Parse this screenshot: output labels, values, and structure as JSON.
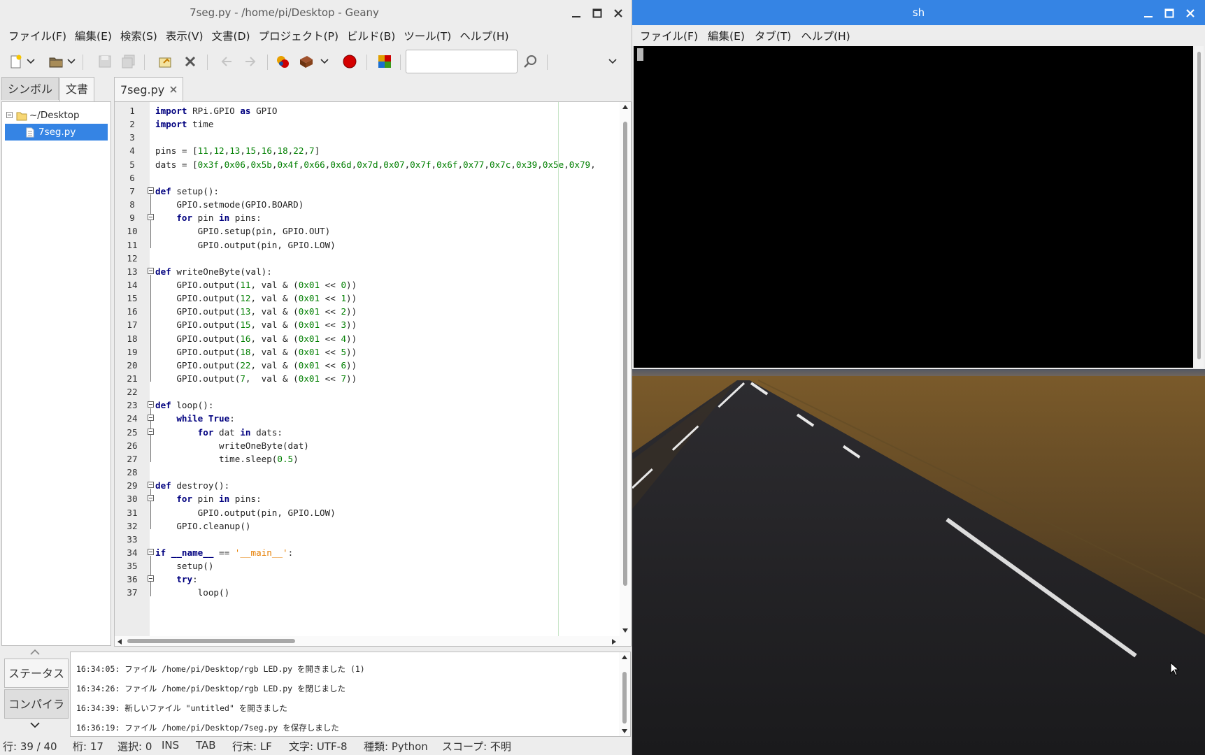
{
  "geany": {
    "title": "7seg.py - /home/pi/Desktop - Geany",
    "menu": [
      "ファイル(F)",
      "編集(E)",
      "検索(S)",
      "表示(V)",
      "文書(D)",
      "プロジェクト(P)",
      "ビルド(B)",
      "ツール(T)",
      "ヘルプ(H)"
    ],
    "toolbar": {
      "icons": [
        "new-file-icon",
        "open-file-icon",
        "save-icon",
        "save-all-icon",
        "revert-icon",
        "close-icon",
        "back-icon",
        "forward-icon",
        "compile-icon",
        "build-icon",
        "run-stop-icon",
        "color-chooser-icon",
        "clear-search-icon",
        "find-icon",
        "overflow-chevron-icon"
      ],
      "search_value": ""
    },
    "sidebar": {
      "tabs": [
        "シンボル",
        "文書"
      ],
      "active_tab": "文書",
      "tree": [
        {
          "label": "~/Desktop",
          "type": "folder",
          "expanded": true
        },
        {
          "label": "7seg.py",
          "type": "file",
          "selected": true
        }
      ]
    },
    "editor": {
      "tab_label": "7seg.py",
      "lines": [
        "import RPi.GPIO as GPIO",
        "import time",
        "",
        "pins = [11,12,13,15,16,18,22,7]",
        "dats = [0x3f,0x06,0x5b,0x4f,0x66,0x6d,0x7d,0x07,0x7f,0x6f,0x77,0x7c,0x39,0x5e,0x79,",
        "",
        "def setup():",
        "    GPIO.setmode(GPIO.BOARD)",
        "    for pin in pins:",
        "        GPIO.setup(pin, GPIO.OUT)",
        "        GPIO.output(pin, GPIO.LOW)",
        "",
        "def writeOneByte(val):",
        "    GPIO.output(11, val & (0x01 << 0))",
        "    GPIO.output(12, val & (0x01 << 1))",
        "    GPIO.output(13, val & (0x01 << 2))",
        "    GPIO.output(15, val & (0x01 << 3))",
        "    GPIO.output(16, val & (0x01 << 4))",
        "    GPIO.output(18, val & (0x01 << 5))",
        "    GPIO.output(22, val & (0x01 << 6))",
        "    GPIO.output(7,  val & (0x01 << 7))",
        "",
        "def loop():",
        "    while True:",
        "        for dat in dats:",
        "            writeOneByte(dat)",
        "            time.sleep(0.5)",
        "",
        "def destroy():",
        "    for pin in pins:",
        "        GPIO.output(pin, GPIO.LOW)",
        "    GPIO.cleanup()",
        "",
        "if __name__ == '__main__':",
        "    setup()",
        "    try:",
        "        loop()"
      ]
    },
    "messages": {
      "tabs": [
        "ステータス",
        "コンパイラ"
      ],
      "lines": [
        "16:34:05: ファイル /home/pi/Desktop/rgb LED.py を開きました (1)",
        "16:34:26: ファイル /home/pi/Desktop/rgb LED.py を閉じました",
        "16:34:39: 新しいファイル \"untitled\" を開きました",
        "16:36:19: ファイル /home/pi/Desktop/7seg.py を保存しました"
      ]
    },
    "status": {
      "line": "行: 39 / 40",
      "col": "桁: 17",
      "sel": "選択: 0",
      "ins": "INS",
      "tab": "TAB",
      "eol": "行末: LF",
      "enc": "文字: UTF-8",
      "ftype": "種類: Python",
      "scope": "スコープ: 不明"
    }
  },
  "terminal": {
    "title": "sh",
    "menu": [
      "ファイル(F)",
      "編集(E)",
      "タブ(T)",
      "ヘルプ(H)"
    ]
  },
  "colors": {
    "keyword": "#00007f",
    "number": "#007f00",
    "string": "#e67e00",
    "selection": "#3584e4",
    "terminal_titlebar": "#3584e4"
  }
}
